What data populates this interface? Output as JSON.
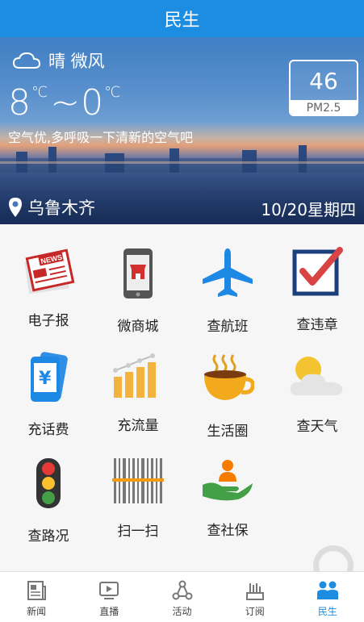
{
  "title": "民生",
  "weather": {
    "condition": "晴 微风",
    "temp_high": "8",
    "temp_low": "0",
    "temp_unit": "℃",
    "separator": "~",
    "advice": "空气优,多呼吸一下清新的空气吧",
    "location": "乌鲁木齐",
    "date": "10/20星期四",
    "pm_value": "46",
    "pm_label": "PM2.5"
  },
  "services": [
    {
      "label": "电子报",
      "icon": "newspaper-icon"
    },
    {
      "label": "微商城",
      "icon": "phone-store-icon"
    },
    {
      "label": "查航班",
      "icon": "airplane-icon"
    },
    {
      "label": "查违章",
      "icon": "checkbox-icon"
    },
    {
      "label": "充话费",
      "icon": "phone-yuan-icon"
    },
    {
      "label": "充流量",
      "icon": "bar-chart-icon"
    },
    {
      "label": "生活圈",
      "icon": "coffee-cup-icon"
    },
    {
      "label": "查天气",
      "icon": "sun-cloud-icon"
    },
    {
      "label": "查路况",
      "icon": "traffic-light-icon"
    },
    {
      "label": "扫一扫",
      "icon": "barcode-icon"
    },
    {
      "label": "查社保",
      "icon": "social-security-icon"
    }
  ],
  "nav": [
    {
      "label": "新闻",
      "icon": "news-icon"
    },
    {
      "label": "直播",
      "icon": "live-icon"
    },
    {
      "label": "活动",
      "icon": "activity-icon"
    },
    {
      "label": "订阅",
      "icon": "subscribe-icon"
    },
    {
      "label": "民生",
      "icon": "people-icon",
      "active": true
    }
  ],
  "colors": {
    "accent": "#1c8de0"
  }
}
